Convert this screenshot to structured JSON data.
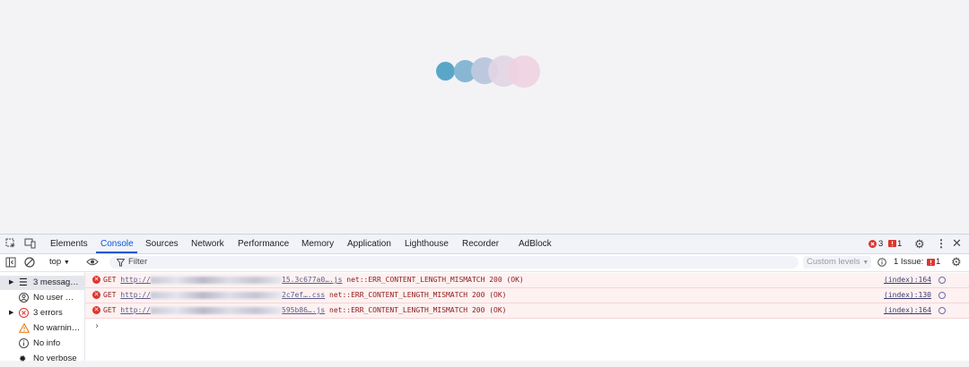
{
  "colors": {
    "dot1": "#5aa6c8",
    "dot2": "#87b7d3",
    "dot3": "#bcc8de",
    "dot4": "#e1d5e3",
    "dot5": "#efd2e1",
    "accent": "#0b57d0",
    "error": "#dc362e"
  },
  "tabs": [
    "Elements",
    "Console",
    "Sources",
    "Network",
    "Performance",
    "Memory",
    "Application",
    "Lighthouse",
    "Recorder",
    "AdBlock"
  ],
  "active_tab": "Console",
  "tabbar_right": {
    "error_count": "3",
    "issue_count": "1"
  },
  "toolbar": {
    "context": "top",
    "filter_placeholder": "Filter",
    "levels": "Custom levels",
    "issues_label": "1 Issue:",
    "issues_count": "1"
  },
  "sidebar": {
    "items": [
      {
        "label": "3 messag…",
        "icon": "list-icon"
      },
      {
        "label": "No user …",
        "icon": "user-icon"
      },
      {
        "label": "3 errors",
        "icon": "error-icon"
      },
      {
        "label": "No warnin…",
        "icon": "warning-icon"
      },
      {
        "label": "No info",
        "icon": "info-icon"
      },
      {
        "label": "No verbose",
        "icon": "bug-icon"
      }
    ]
  },
  "console": {
    "rows": [
      {
        "method": "GET",
        "url_prefix": "http://",
        "url_suffix": "15.3c677a0….js",
        "message": "net::ERR_CONTENT_LENGTH_MISMATCH 200 (OK)",
        "source": "(index):164"
      },
      {
        "method": "GET",
        "url_prefix": "http://",
        "url_suffix": "2c7ef….css",
        "message": "net::ERR_CONTENT_LENGTH_MISMATCH 200 (OK)",
        "source": "(index):130"
      },
      {
        "method": "GET",
        "url_prefix": "http://",
        "url_suffix": "595b86….js",
        "message": "net::ERR_CONTENT_LENGTH_MISMATCH 200 (OK)",
        "source": "(index):164"
      }
    ],
    "prompt": "›"
  }
}
